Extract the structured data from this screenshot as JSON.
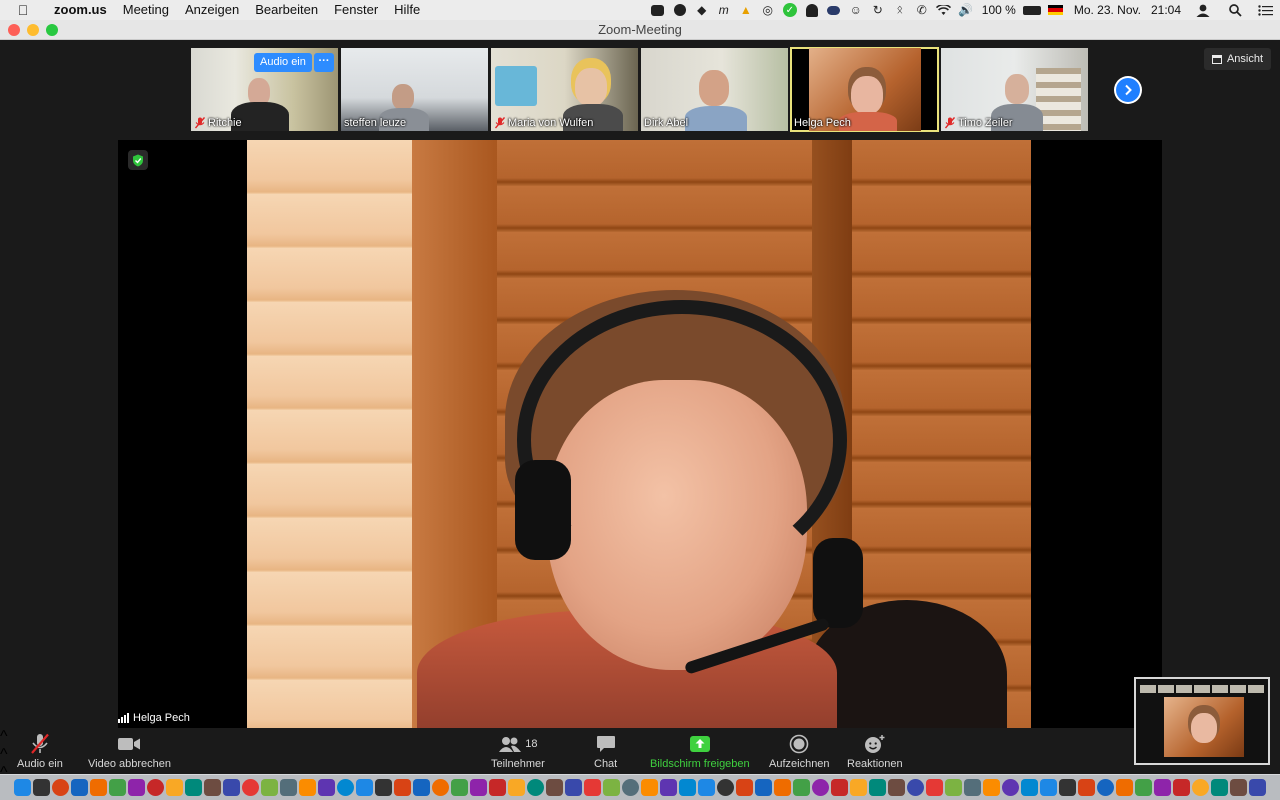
{
  "menubar": {
    "app_name": "zoom.us",
    "menus": [
      "Meeting",
      "Anzeigen",
      "Bearbeiten",
      "Fenster",
      "Hilfe"
    ],
    "battery": "100 %",
    "date": "Mo. 23. Nov.",
    "time": "21:04",
    "status_icons": [
      "zoom-icon",
      "check-circle-icon",
      "dropbox-icon",
      "script-icon",
      "warning-icon",
      "microphone-icon",
      "green-check-icon",
      "ghost-icon",
      "cloud-icon",
      "accessibility-icon",
      "time-machine-icon",
      "bluetooth-icon",
      "phone-icon",
      "wifi-icon",
      "volume-icon",
      "battery-icon",
      "german-flag-icon"
    ]
  },
  "window": {
    "title": "Zoom-Meeting"
  },
  "gallery": {
    "participants": [
      {
        "name": "Ritchie",
        "muted": true
      },
      {
        "name": "steffen leuze",
        "muted": false
      },
      {
        "name": "Maria von Wulfen",
        "muted": true
      },
      {
        "name": "Dirk Abel",
        "muted": false
      },
      {
        "name": "Helga Pech",
        "muted": false,
        "active": true
      },
      {
        "name": "Timo Zeiler",
        "muted": true
      }
    ],
    "audio_chip": "Audio ein",
    "more_chip": "···"
  },
  "view_button": "Ansicht",
  "main": {
    "speaker": "Helga Pech"
  },
  "controls": {
    "audio": "Audio ein",
    "video": "Video abbrechen",
    "participants": "Teilnehmer",
    "participant_count": "18",
    "chat": "Chat",
    "share": "Bildschirm freigeben",
    "record": "Aufzeichnen",
    "reactions": "Reaktionen"
  },
  "colors": {
    "accent_blue": "#2d8cff",
    "active_speaker": "#e9e27b",
    "share_green": "#3fd13f",
    "muted_red": "#e02828"
  }
}
